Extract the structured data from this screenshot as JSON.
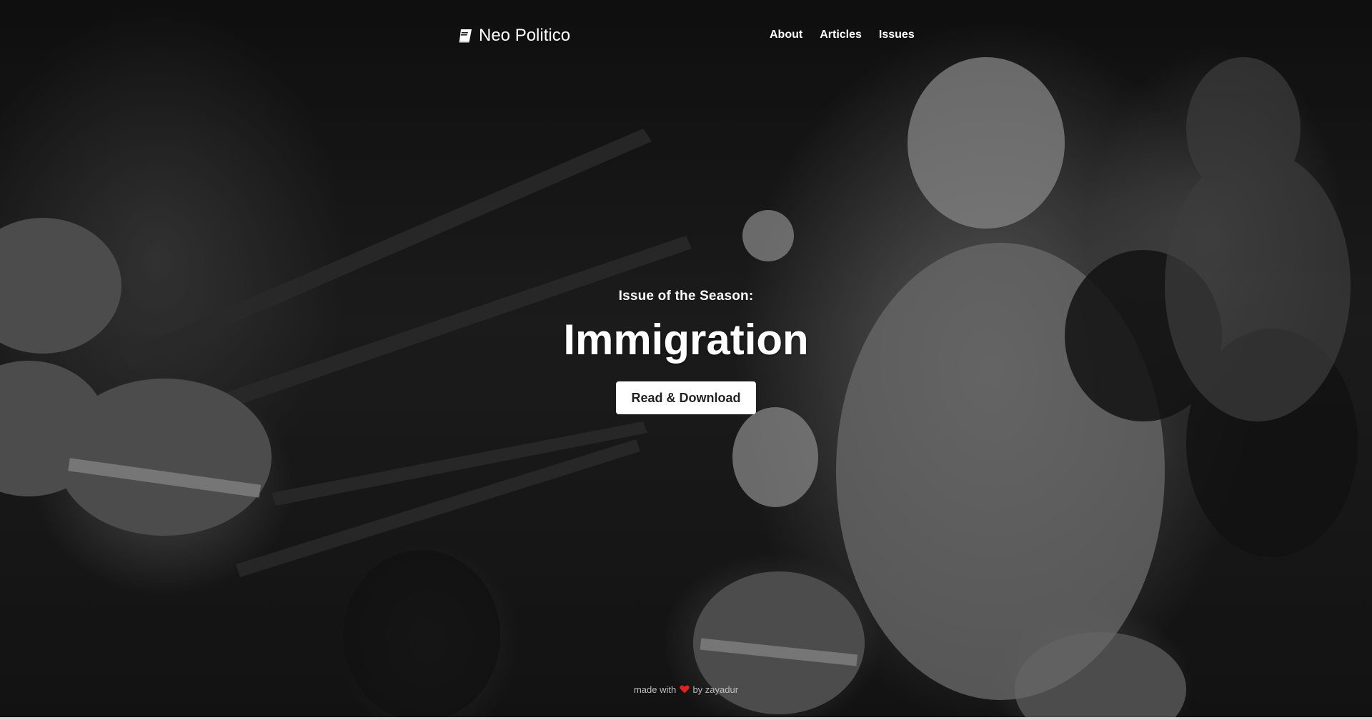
{
  "brand": {
    "name": "Neo Politico",
    "icon": "book-icon"
  },
  "nav": {
    "items": [
      {
        "label": "About"
      },
      {
        "label": "Articles"
      },
      {
        "label": "Issues"
      }
    ]
  },
  "hero": {
    "kicker": "Issue of the Season:",
    "title": "Immigration",
    "button_label": "Read & Download",
    "background": "black-and-white protest photo (person offering flower to soldiers' rifles)"
  },
  "footer": {
    "made_with": "made with",
    "heart_icon": "heart-icon",
    "by": "by zayadur"
  },
  "colors": {
    "text": "#ffffff",
    "button_bg": "#ffffff",
    "button_text": "#222222",
    "heart": "#e02424",
    "footer_text": "#bdbdbd"
  }
}
